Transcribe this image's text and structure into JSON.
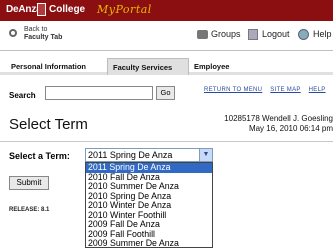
{
  "header": {
    "brand": "DeAnza",
    "college": "College",
    "portal": "MyPortal"
  },
  "nav": {
    "back_line1": "Back to",
    "back_line2": "Faculty Tab",
    "groups": "Groups",
    "logout": "Logout",
    "help": "Help"
  },
  "tabs": [
    {
      "label": "Personal Information"
    },
    {
      "label": "Faculty Services"
    },
    {
      "label": "Employee"
    }
  ],
  "search": {
    "label": "Search",
    "value": "",
    "go_label": "Go",
    "links": [
      "RETURN TO MENU",
      "SITE MAP",
      "HELP"
    ]
  },
  "page": {
    "title": "Select Term",
    "user_line1": "10285178 Wendell J. Goesling",
    "user_line2": "May 16, 2010 06:14 pm"
  },
  "term": {
    "label": "Select a Term:",
    "selected": "2011 Spring De Anza",
    "options": [
      "2011 Spring De Anza",
      "2010 Fall De Anza",
      "2010 Summer De Anza",
      "2010 Spring De Anza",
      "2010 Winter De Anza",
      "2010 Winter Foothill",
      "2009 Fall De Anza",
      "2009 Fall Foothill",
      "2009 Summer De Anza"
    ]
  },
  "submit_label": "Submit",
  "release": "RELEASE: 8.1",
  "colors": {
    "header_bg": "#8b0f11",
    "portal_text": "#e6b800",
    "selection": "#316ac5",
    "link": "#2a4aa0"
  }
}
